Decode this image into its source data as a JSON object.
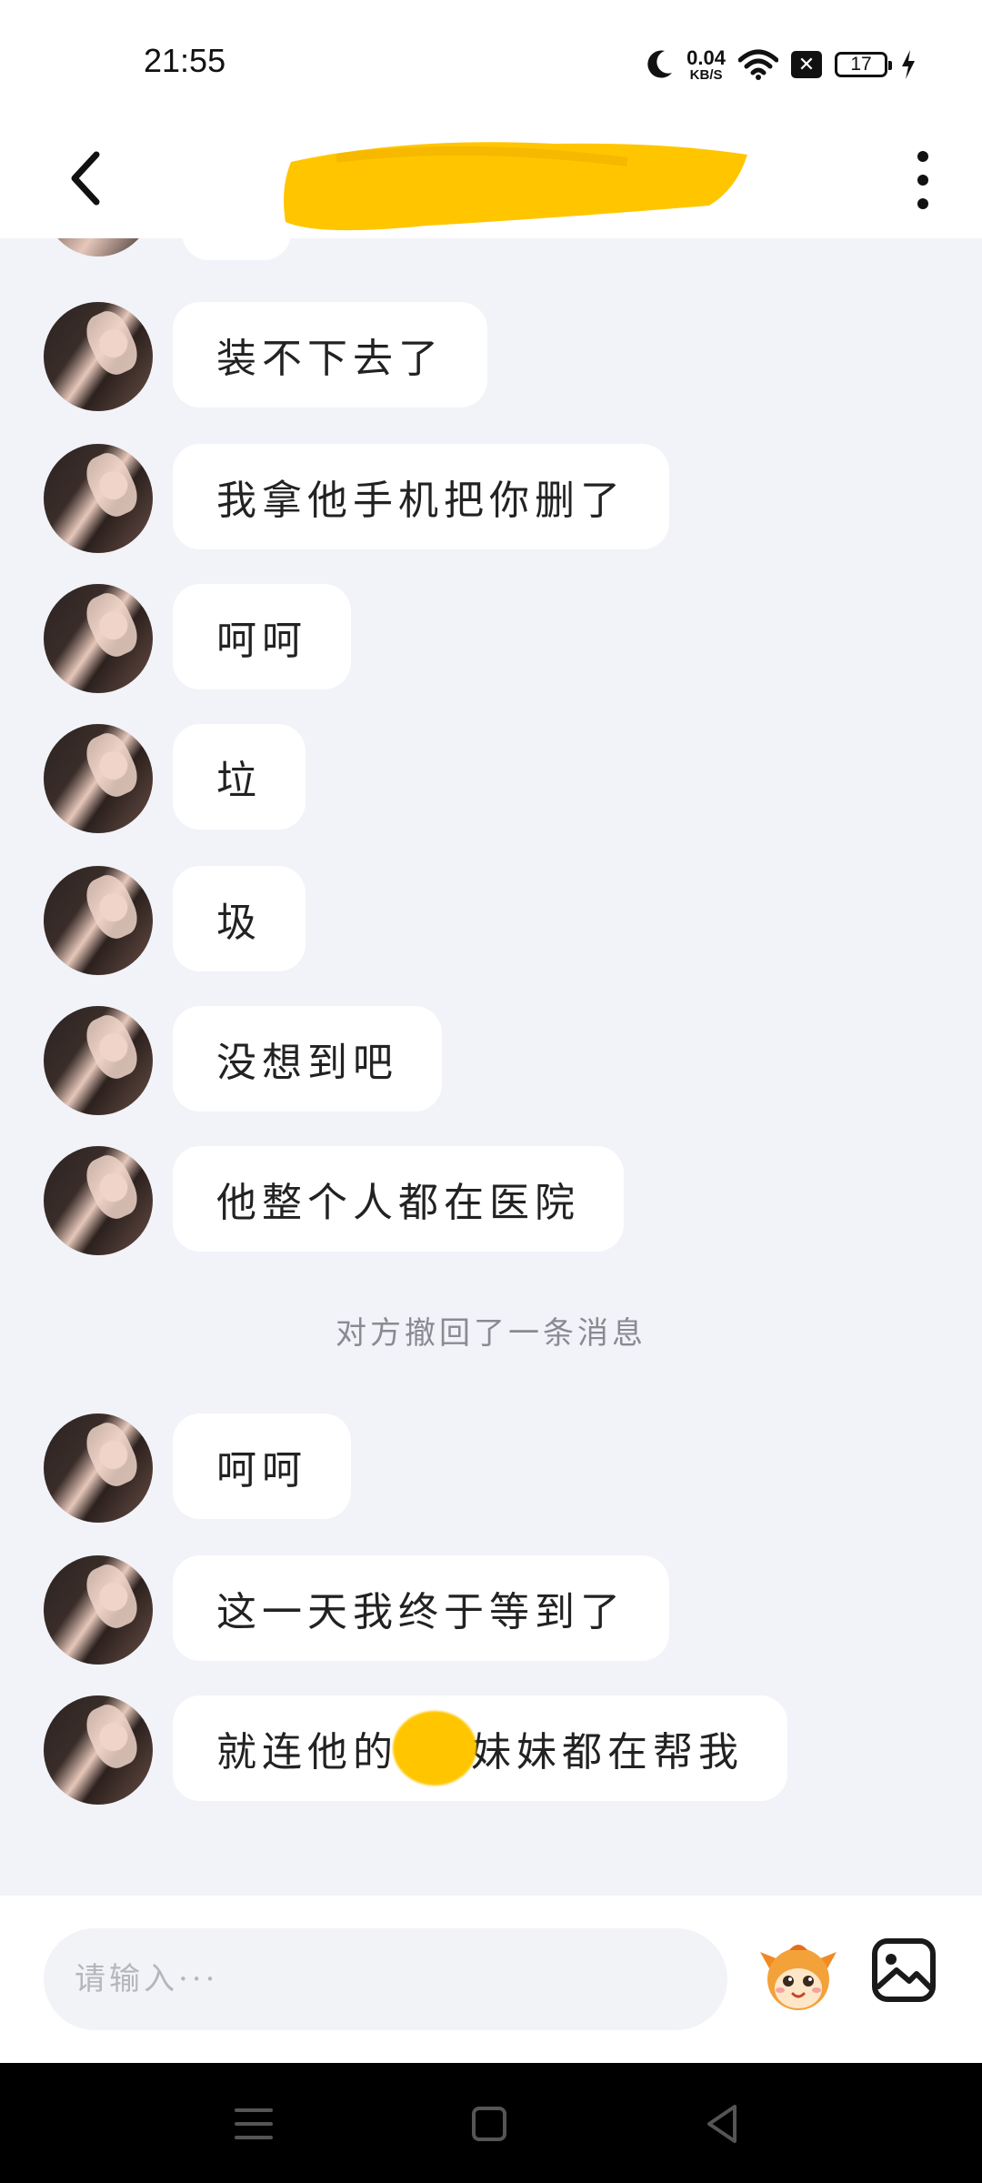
{
  "status_bar": {
    "time": "21:55",
    "net_speed_value": "0.04",
    "net_speed_unit": "KB/S",
    "battery_level": "17",
    "icons": [
      "moon-icon",
      "wifi-icon",
      "no-sim-icon",
      "battery-icon",
      "charging-icon"
    ]
  },
  "header": {
    "back_icon": "chevron-left-icon",
    "title_redacted": true,
    "more_icon": "more-vertical-icon"
  },
  "messages": [
    {
      "text": "装不下去了"
    },
    {
      "text": "我拿他手机把你删了"
    },
    {
      "text": "呵呵"
    },
    {
      "text": "垃"
    },
    {
      "text": "圾"
    },
    {
      "text": "没想到吧"
    },
    {
      "text": "他整个人都在医院"
    },
    {
      "text": "呵呵"
    },
    {
      "text": "这一天我终于等到了"
    },
    {
      "text_before": "就连他的",
      "text_after": "妹妹都在帮我"
    }
  ],
  "system_notice": "对方撤回了一条消息",
  "input": {
    "placeholder": "请输入···"
  },
  "colors": {
    "background": "#f2f3f8",
    "bubble": "#ffffff",
    "redaction": "#ffc600",
    "navbar": "#000000"
  }
}
